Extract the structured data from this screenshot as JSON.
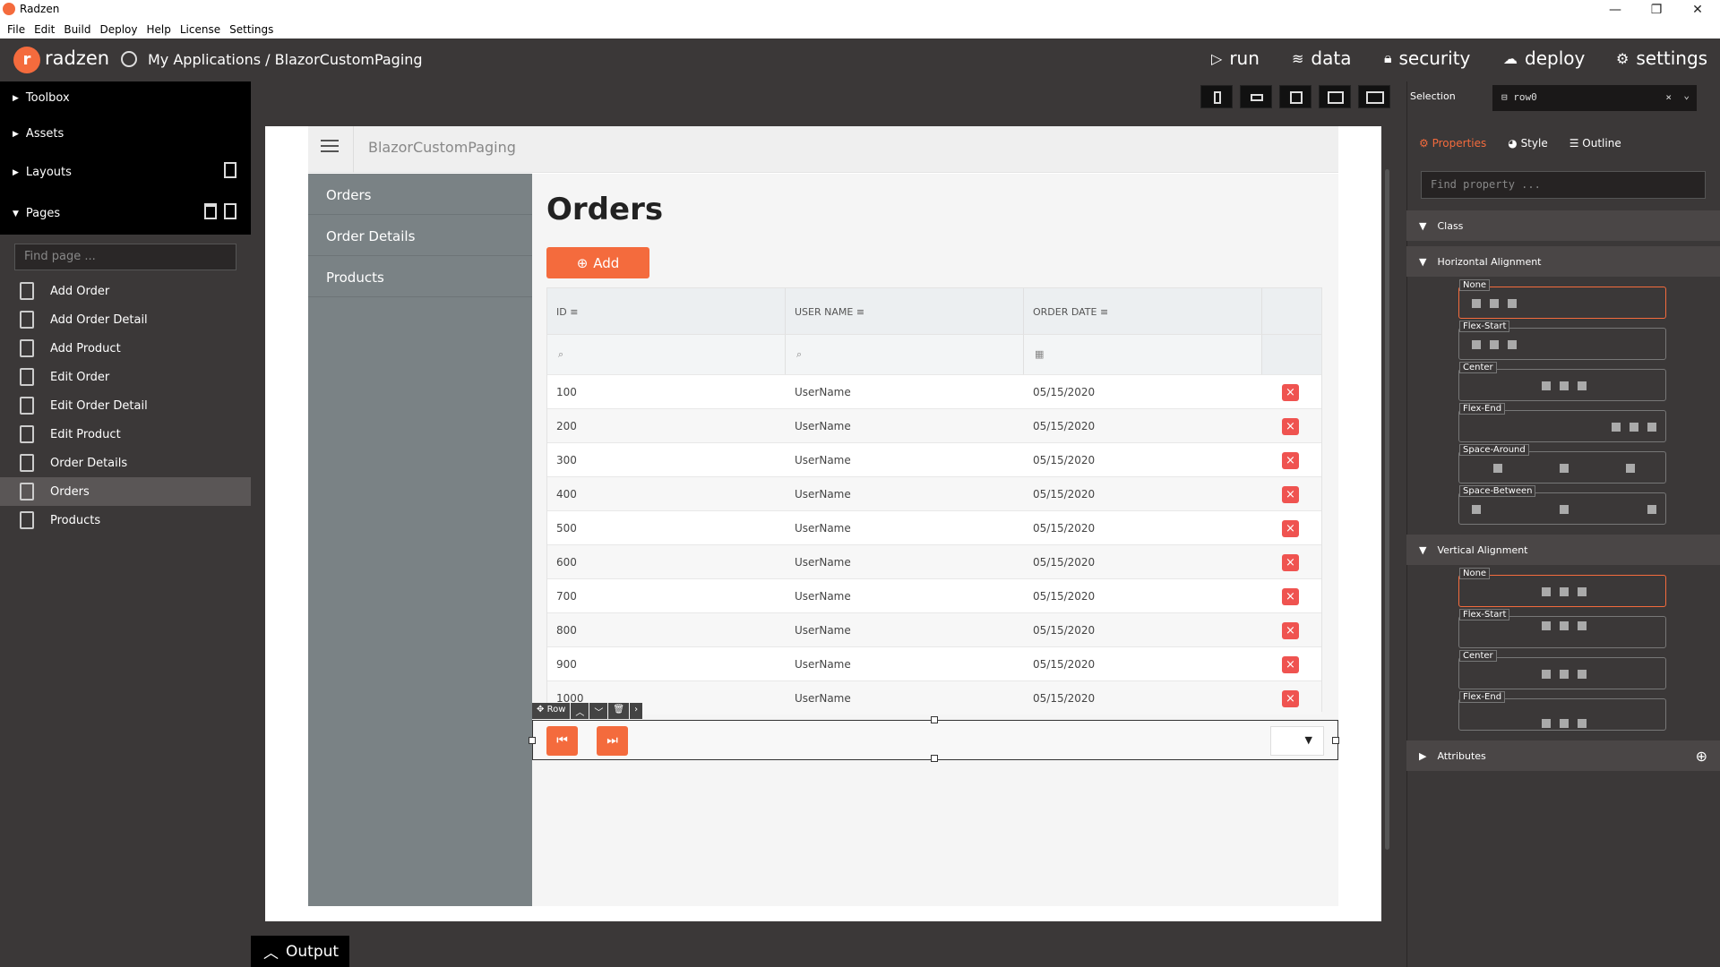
{
  "window": {
    "title": "Radzen"
  },
  "menubar": [
    "File",
    "Edit",
    "Build",
    "Deploy",
    "Help",
    "License",
    "Settings"
  ],
  "topbar": {
    "brand": "radzen",
    "breadcrumb": "My Applications / BlazorCustomPaging",
    "nav": {
      "run": "run",
      "data": "data",
      "security": "security",
      "deploy": "deploy",
      "settings": "settings"
    }
  },
  "sidebar": {
    "tree": [
      "Toolbox",
      "Assets",
      "Layouts",
      "Pages"
    ],
    "find_placeholder": "Find page ...",
    "pages": [
      "Add Order",
      "Add Order Detail",
      "Add Product",
      "Edit Order",
      "Edit Order Detail",
      "Edit Product",
      "Order Details",
      "Orders",
      "Products"
    ],
    "active_page": "Orders"
  },
  "app": {
    "title": "BlazorCustomPaging",
    "nav": [
      "Orders",
      "Order Details",
      "Products"
    ],
    "heading": "Orders",
    "add_label": "Add",
    "columns": [
      "ID",
      "USER NAME",
      "ORDER DATE"
    ],
    "rows": [
      {
        "id": "100",
        "user": "UserName",
        "date": "05/15/2020"
      },
      {
        "id": "200",
        "user": "UserName",
        "date": "05/15/2020"
      },
      {
        "id": "300",
        "user": "UserName",
        "date": "05/15/2020"
      },
      {
        "id": "400",
        "user": "UserName",
        "date": "05/15/2020"
      },
      {
        "id": "500",
        "user": "UserName",
        "date": "05/15/2020"
      },
      {
        "id": "600",
        "user": "UserName",
        "date": "05/15/2020"
      },
      {
        "id": "700",
        "user": "UserName",
        "date": "05/15/2020"
      },
      {
        "id": "800",
        "user": "UserName",
        "date": "05/15/2020"
      },
      {
        "id": "900",
        "user": "UserName",
        "date": "05/15/2020"
      },
      {
        "id": "1000",
        "user": "UserName",
        "date": "05/15/2020"
      }
    ],
    "row_toolbar_label": "Row"
  },
  "output_label": "Output",
  "properties": {
    "selection_label": "Selection",
    "selection_value": "row0",
    "tabs": [
      "Properties",
      "Style",
      "Outline"
    ],
    "find_placeholder": "Find property ...",
    "sections": {
      "class": "Class",
      "horizontal": "Horizontal Alignment",
      "vertical": "Vertical Alignment",
      "attributes": "Attributes"
    },
    "horizontal_options": [
      "None",
      "Flex-Start",
      "Center",
      "Flex-End",
      "Space-Around",
      "Space-Between"
    ],
    "vertical_options": [
      "None",
      "Flex-Start",
      "Center",
      "Flex-End"
    ]
  },
  "colors": {
    "accent": "#f46b3d",
    "danger": "#ef5350",
    "dark": "#3b3838"
  }
}
